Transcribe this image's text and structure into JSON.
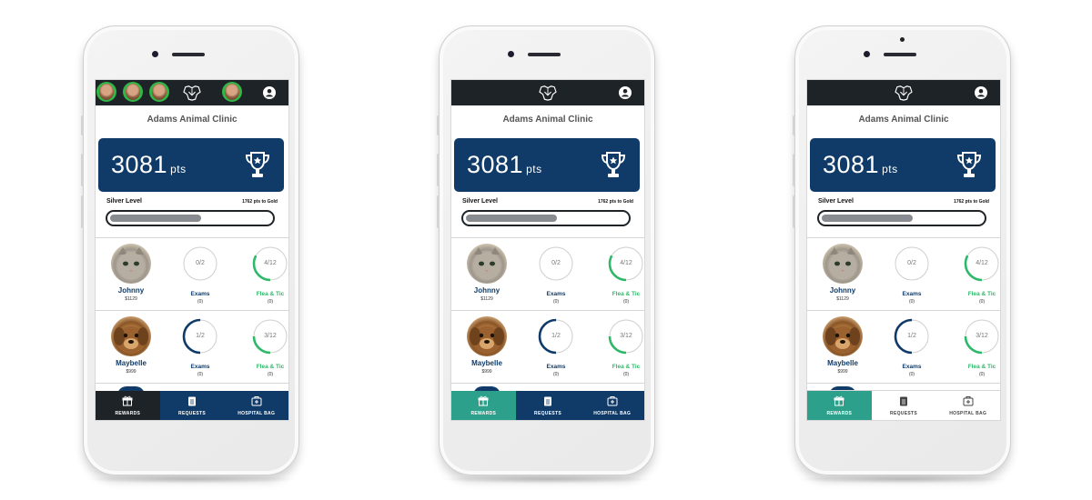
{
  "app": {
    "clinic_name": "Adams Animal Clinic",
    "points_value": "3081",
    "points_unit": "pts",
    "level_label": "Silver Level",
    "to_next_level": "1762 pts to Gold",
    "level_progress": 0.57
  },
  "pets": [
    {
      "name": "Johnny",
      "amount": "$1129",
      "photo": "cat",
      "stats": [
        {
          "label": "Exams",
          "sub": "(0)",
          "value": "0/2",
          "fraction": 0,
          "color": "#103b68"
        },
        {
          "label": "Flea & Tic",
          "sub": "(0)",
          "value": "4/12",
          "fraction": 0.33,
          "color": "#2fb869"
        }
      ]
    },
    {
      "name": "Maybelle",
      "amount": "$999",
      "photo": "dog",
      "stats": [
        {
          "label": "Exams",
          "sub": "(0)",
          "value": "1/2",
          "fraction": 0.5,
          "color": "#103b68"
        },
        {
          "label": "Flea & Tic",
          "sub": "(0)",
          "value": "3/12",
          "fraction": 0.25,
          "color": "#2fb869"
        }
      ]
    }
  ],
  "tabs": [
    {
      "label": "REWARDS",
      "icon": "gift-icon"
    },
    {
      "label": "REQUESTS",
      "icon": "clipboard-icon"
    },
    {
      "label": "HOSPITAL BAG",
      "icon": "medical-bag-icon"
    }
  ],
  "variants": [
    {
      "status_bar": "avatars",
      "tab_theme": "dark",
      "rewards_bg": "#1e2328",
      "bar_bg": "#103b68",
      "tab_text": "#ffffff"
    },
    {
      "status_bar": "plain",
      "tab_theme": "teal",
      "rewards_bg": "#2ca08a",
      "bar_bg": "#103b68",
      "tab_text": "#ffffff"
    },
    {
      "status_bar": "plain",
      "tab_theme": "light",
      "rewards_bg": "#2ca08a",
      "bar_bg": "#ffffff",
      "tab_text": "#444444"
    }
  ],
  "colors": {
    "navy": "#103b68",
    "dark": "#1e2328",
    "teal": "#2ca08a",
    "green": "#2fb869"
  }
}
